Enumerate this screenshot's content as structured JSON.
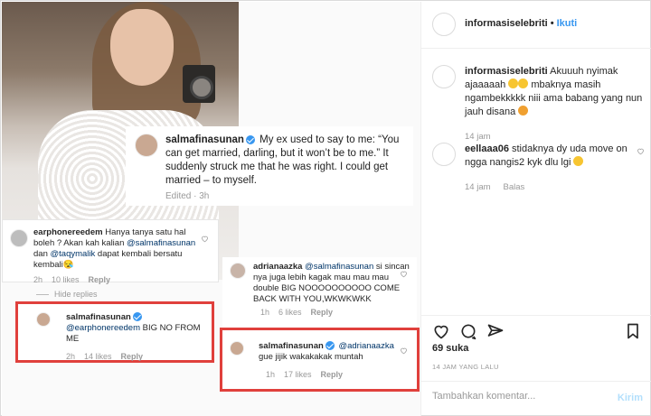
{
  "image": {
    "quote": {
      "username": "salmafinasunan",
      "text": "My ex used to say to me: “You can get married, darling, but it won’t be to me.” It suddenly struck me that he was right. I could get married – to myself.",
      "edited": "Edited · 3h"
    },
    "comment1": {
      "username": "earphonereedem",
      "text_before": "Hanya tanya satu hal boleh ? Akan kah kalian ",
      "mention1": "@salmafinasunan",
      "text_mid": " dan ",
      "mention2": "@taqymalik",
      "text_after": " dapat kembali bersatu kembali😪",
      "time": "2h",
      "likes": "10 likes",
      "reply": "Reply"
    },
    "hide_replies": "Hide replies",
    "reply1": {
      "username": "salmafinasunan",
      "mention": "@earphonereedem",
      "text": " BIG NO FROM ME",
      "time": "2h",
      "likes": "14 likes",
      "reply": "Reply"
    },
    "reply2": {
      "username": "adrianaazka",
      "mention": "@salmafinasunan",
      "text": " si sincan nya juga lebih kagak mau mau mau double BIG NOOOOOOOOOO COME BACK WITH YOU,WKWKWKK",
      "time": "1h",
      "likes": "6 likes",
      "reply": "Reply"
    },
    "reply3": {
      "username": "salmafinasunan",
      "mention": "@adrianaazka",
      "text": " gue jijik wakakakak muntah",
      "time": "1h",
      "likes": "17 likes",
      "reply": "Reply"
    }
  },
  "panel": {
    "header": {
      "username": "informasiselebriti",
      "dot": "•",
      "follow": "Ikuti"
    },
    "comments": [
      {
        "username": "informasiselebriti",
        "text_a": " Akuuuh nyimak ajaaaaah ",
        "text_b": " mbaknya masih ngambekkkkk niii ama babang yang nun jauh disana ",
        "time": "14 jam"
      },
      {
        "username": "eellaaa06",
        "text": " stidaknya dy uda move on ngga nangis2 kyk dlu lgi ",
        "time": "14 jam",
        "reply": "Balas"
      }
    ],
    "likes": "69 suka",
    "date": "14 JAM YANG LALU",
    "add_comment_placeholder": "Tambahkan komentar...",
    "post_label": "Kirim"
  },
  "colors": {
    "highlight": "#e0403c",
    "link": "#003569",
    "accent": "#3897f0"
  }
}
